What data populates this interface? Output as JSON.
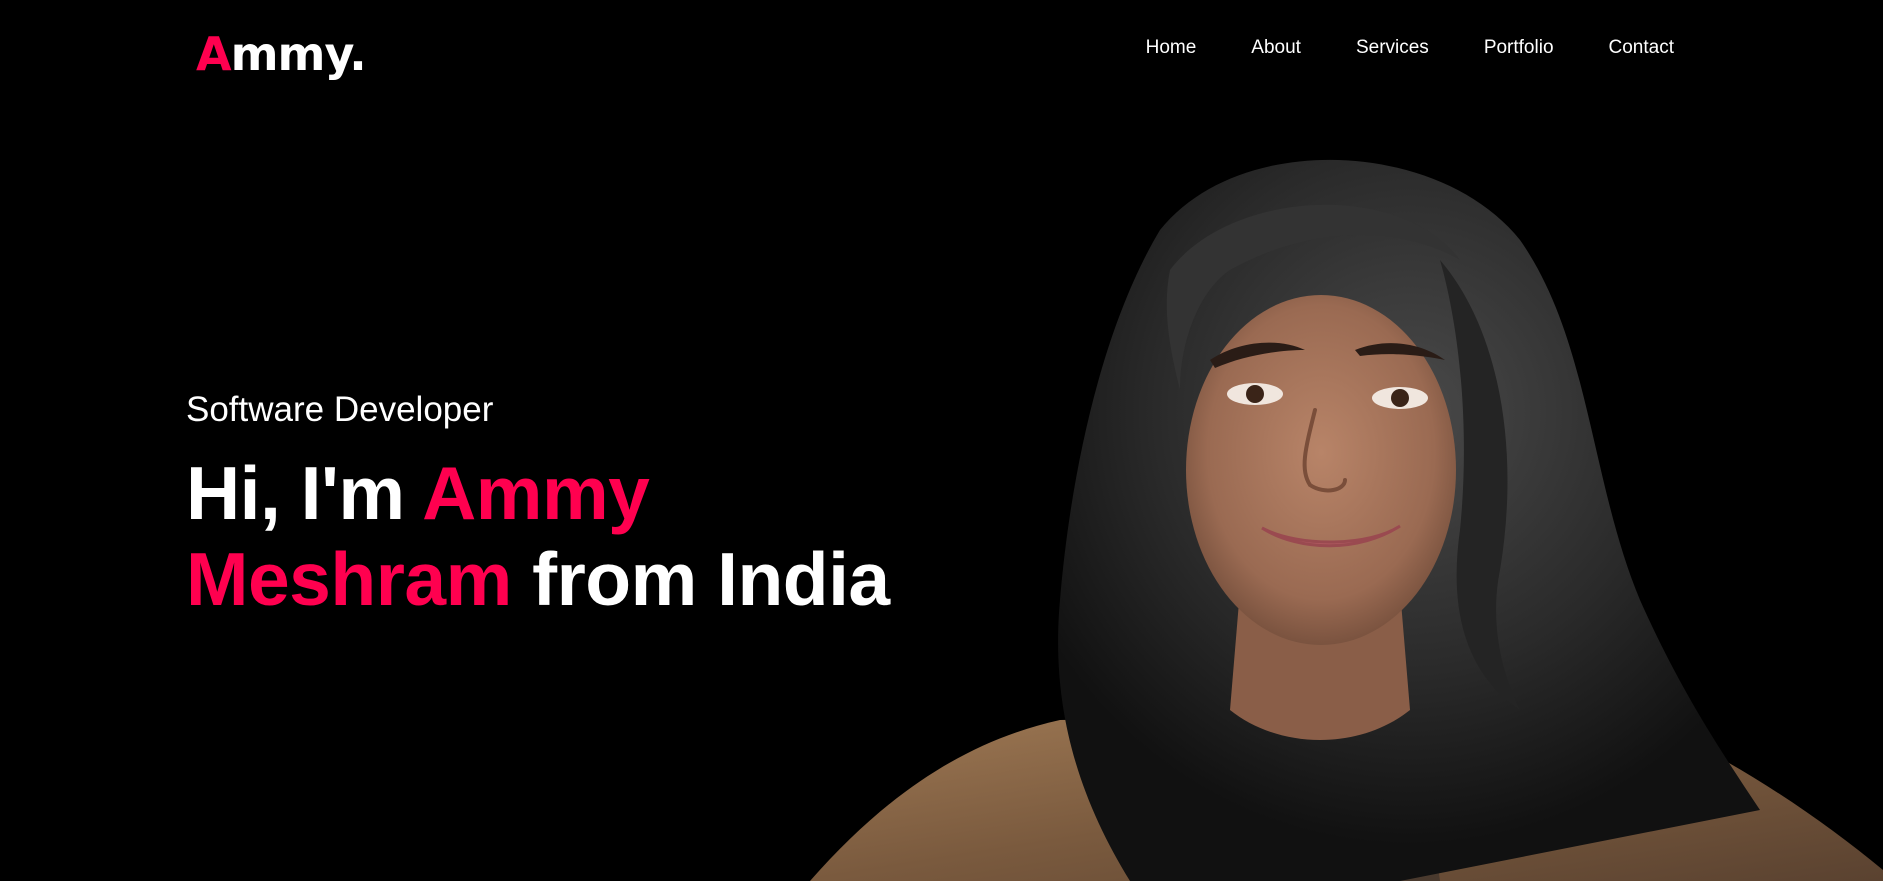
{
  "brand": {
    "logo_initial": "A",
    "logo_rest": "mmy.",
    "accent_color": "#ff004f"
  },
  "nav": {
    "items": [
      {
        "label": "Home"
      },
      {
        "label": "About"
      },
      {
        "label": "Services"
      },
      {
        "label": "Portfolio"
      },
      {
        "label": "Contact"
      }
    ]
  },
  "hero": {
    "subtitle": "Software Developer",
    "greeting": "Hi, I'm ",
    "name": "Ammy Meshram",
    "suffix": " from India",
    "photo_icon": "portrait-photo"
  }
}
